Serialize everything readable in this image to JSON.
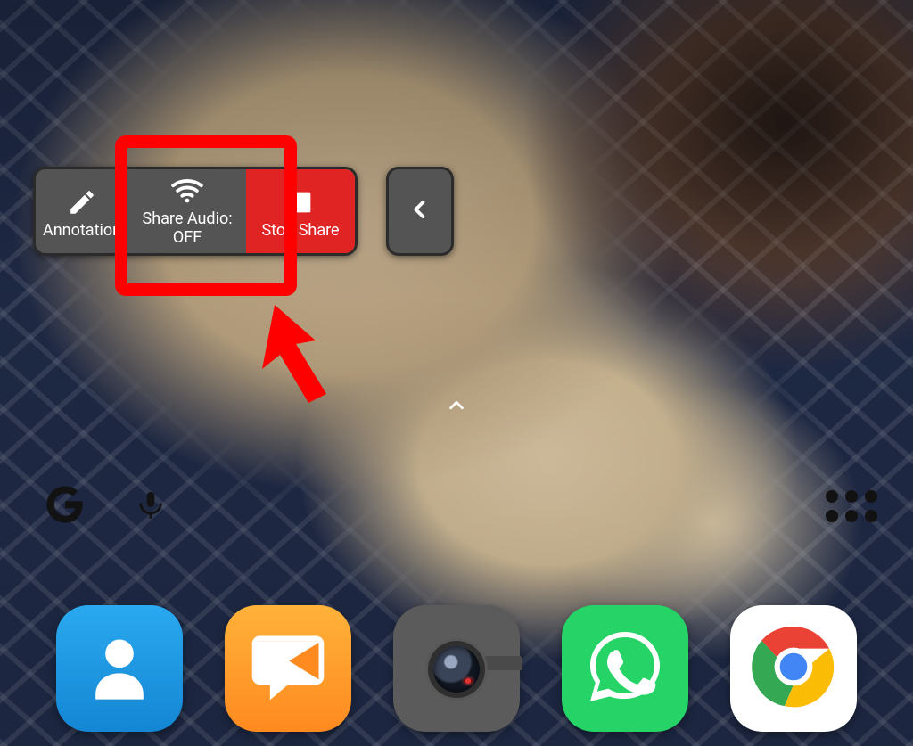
{
  "share_toolbar": {
    "annotation_label": "Annotation",
    "share_audio_label": "Share Audio:",
    "share_audio_state": "OFF",
    "stop_share_label": "Stop Share"
  },
  "highlight": {
    "color": "#ff0000"
  },
  "home": {
    "caret_icon": "chevron-up-icon"
  },
  "search_row": {
    "google_icon": "google-g-icon",
    "mic_icon": "mic-icon",
    "app_drawer_icon": "app-drawer-icon"
  },
  "dock": [
    {
      "name": "contacts",
      "icon": "contacts-person-icon"
    },
    {
      "name": "messages",
      "icon": "messages-bubble-icon"
    },
    {
      "name": "camera",
      "icon": "camera-icon"
    },
    {
      "name": "whatsapp",
      "icon": "whatsapp-icon"
    },
    {
      "name": "chrome",
      "icon": "chrome-icon"
    }
  ]
}
